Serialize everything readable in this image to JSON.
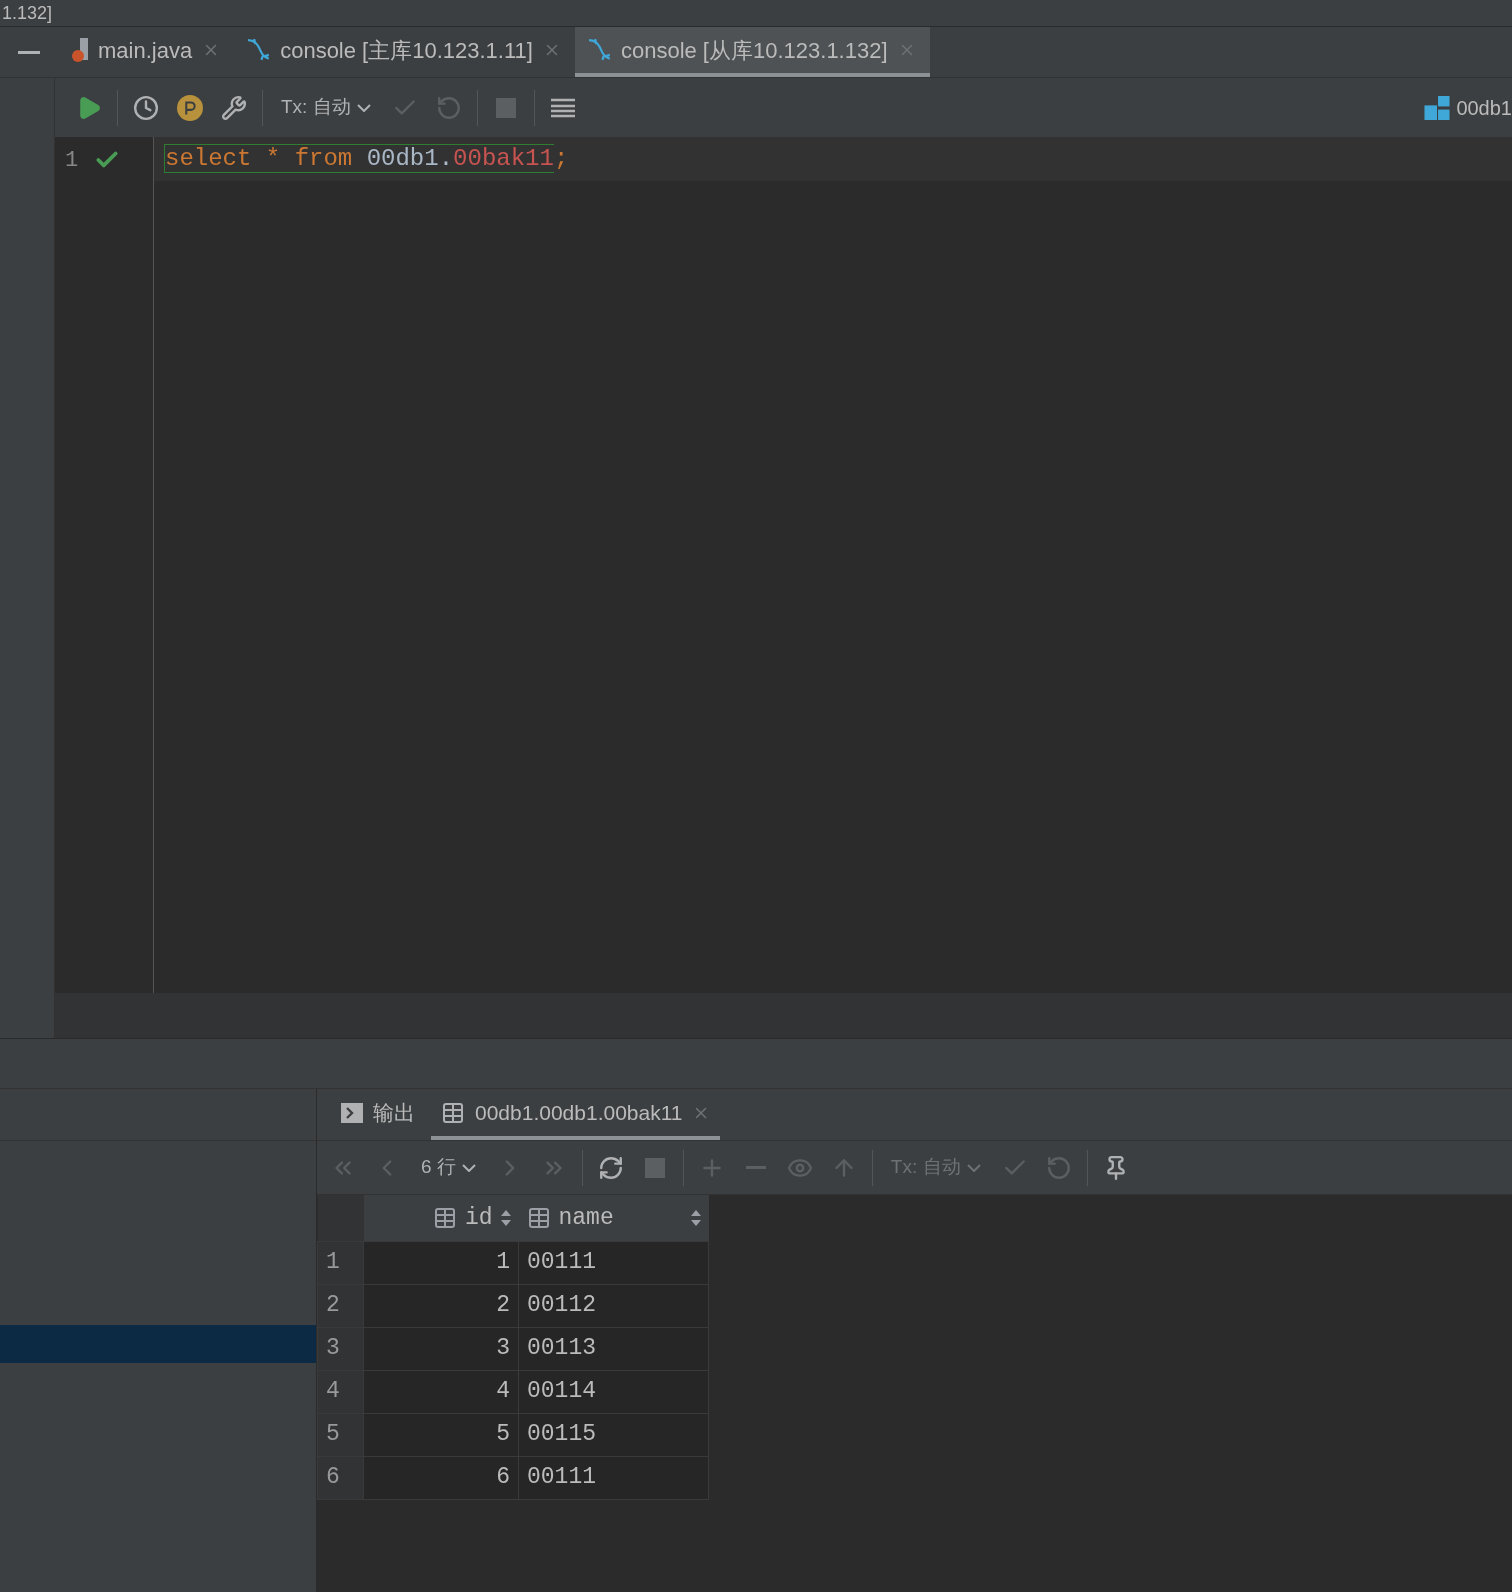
{
  "title": "1.132]",
  "editor_tabs": [
    {
      "label": "main.java",
      "kind": "java",
      "selected": false
    },
    {
      "label": "console [主库10.123.1.11]",
      "kind": "console",
      "selected": false
    },
    {
      "label": "console [从库10.123.1.132]",
      "kind": "console",
      "selected": true
    }
  ],
  "toolbar": {
    "items": [
      {
        "kind": "run",
        "disabled": false
      },
      {
        "kind": "sep"
      },
      {
        "kind": "history",
        "disabled": false
      },
      {
        "kind": "p",
        "disabled": false
      },
      {
        "kind": "wrench",
        "disabled": false
      },
      {
        "kind": "sep"
      },
      {
        "kind": "tx",
        "label": "Tx: 自动",
        "disabled": false
      },
      {
        "kind": "commit",
        "disabled": true
      },
      {
        "kind": "rollback",
        "disabled": true
      },
      {
        "kind": "sep"
      },
      {
        "kind": "stop",
        "disabled": true
      },
      {
        "kind": "sep"
      },
      {
        "kind": "table",
        "disabled": false
      }
    ],
    "schema": "00db1"
  },
  "editor": {
    "lines": [
      {
        "number": "1",
        "ok": true,
        "tokens": [
          {
            "text": "select",
            "kind": "keyword"
          },
          {
            "text": " *",
            "kind": "keyword"
          },
          {
            "text": " from",
            "kind": "keyword"
          },
          {
            "text": " 00db1.",
            "kind": "plain"
          },
          {
            "text": "00bak11",
            "kind": "error"
          },
          {
            "text": ";",
            "kind": "keyword"
          }
        ]
      }
    ]
  },
  "results": {
    "tabs": [
      {
        "label": "输出",
        "kind": "output",
        "selected": false
      },
      {
        "label": "00db1.00db1.00bak11",
        "kind": "table",
        "selected": true
      }
    ],
    "toolbar": {
      "items": [
        {
          "kind": "first",
          "disabled": true
        },
        {
          "kind": "prev",
          "disabled": true
        },
        {
          "kind": "rows",
          "label": "6 行",
          "disabled": false
        },
        {
          "kind": "next",
          "disabled": true
        },
        {
          "kind": "last",
          "disabled": true
        },
        {
          "kind": "sep"
        },
        {
          "kind": "refresh",
          "disabled": false
        },
        {
          "kind": "stop",
          "disabled": true
        },
        {
          "kind": "sep"
        },
        {
          "kind": "add",
          "disabled": true
        },
        {
          "kind": "remove",
          "disabled": true
        },
        {
          "kind": "view",
          "disabled": true
        },
        {
          "kind": "up",
          "disabled": true
        },
        {
          "kind": "sep"
        },
        {
          "kind": "tx",
          "label": "Tx: 自动",
          "disabled": true
        },
        {
          "kind": "commit",
          "disabled": true
        },
        {
          "kind": "rollback",
          "disabled": true
        },
        {
          "kind": "sep"
        },
        {
          "kind": "pin",
          "disabled": false
        }
      ]
    },
    "table": {
      "columns": [
        "",
        "id",
        "name"
      ],
      "rows": [
        [
          "1",
          "1",
          "00111"
        ],
        [
          "2",
          "2",
          "00112"
        ],
        [
          "3",
          "3",
          "00113"
        ],
        [
          "4",
          "4",
          "00114"
        ],
        [
          "5",
          "5",
          "00115"
        ],
        [
          "6",
          "6",
          "00111"
        ]
      ]
    }
  }
}
